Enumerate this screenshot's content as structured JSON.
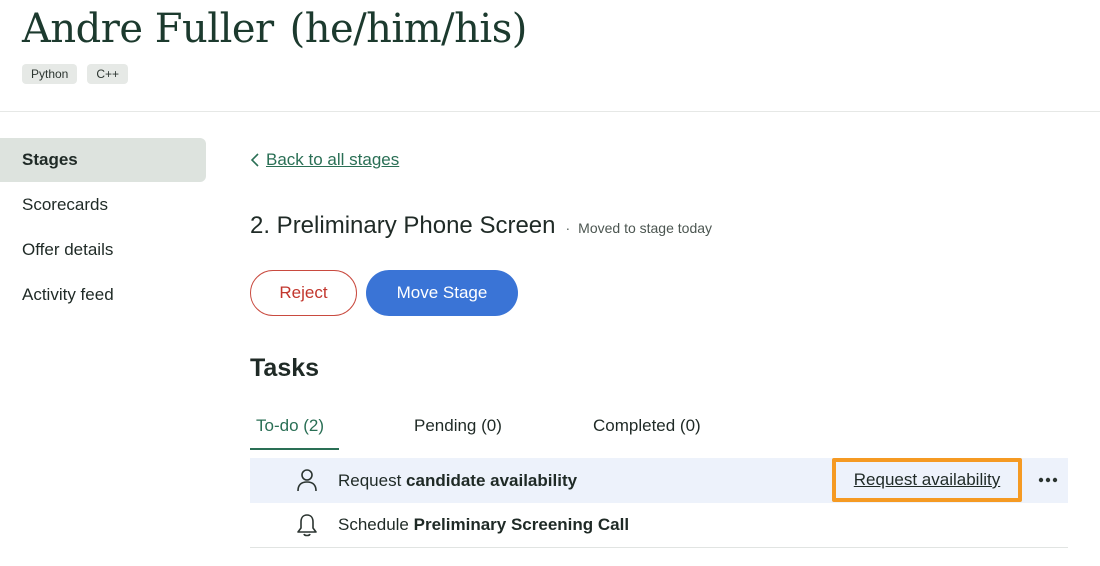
{
  "candidate": {
    "name": "Andre Fuller",
    "pronouns": "(he/him/his)",
    "tags": [
      "Python",
      "C++"
    ]
  },
  "sidebar": {
    "items": [
      {
        "label": "Stages",
        "active": true
      },
      {
        "label": "Scorecards",
        "active": false
      },
      {
        "label": "Offer details",
        "active": false
      },
      {
        "label": "Activity feed",
        "active": false
      }
    ]
  },
  "stage": {
    "back_link": "Back to all stages",
    "title": "2. Preliminary Phone Screen",
    "separator": "·",
    "meta": "Moved to stage today",
    "reject_label": "Reject",
    "move_label": "Move Stage"
  },
  "tasks": {
    "title": "Tasks",
    "tabs": [
      {
        "label": "To-do (2)",
        "active": true
      },
      {
        "label": "Pending (0)",
        "active": false
      },
      {
        "label": "Completed (0)",
        "active": false
      }
    ],
    "rows": [
      {
        "prefix": "Request ",
        "bold": "candidate availability",
        "icon": "person-icon",
        "action": "Request availability"
      },
      {
        "prefix": "Schedule ",
        "bold": "Preliminary Screening Call",
        "icon": "bell-icon"
      }
    ]
  },
  "colors": {
    "accent": "#2a6f55",
    "primary_button": "#3a74d6",
    "reject": "#c2362d",
    "highlight": "#f59a23"
  }
}
